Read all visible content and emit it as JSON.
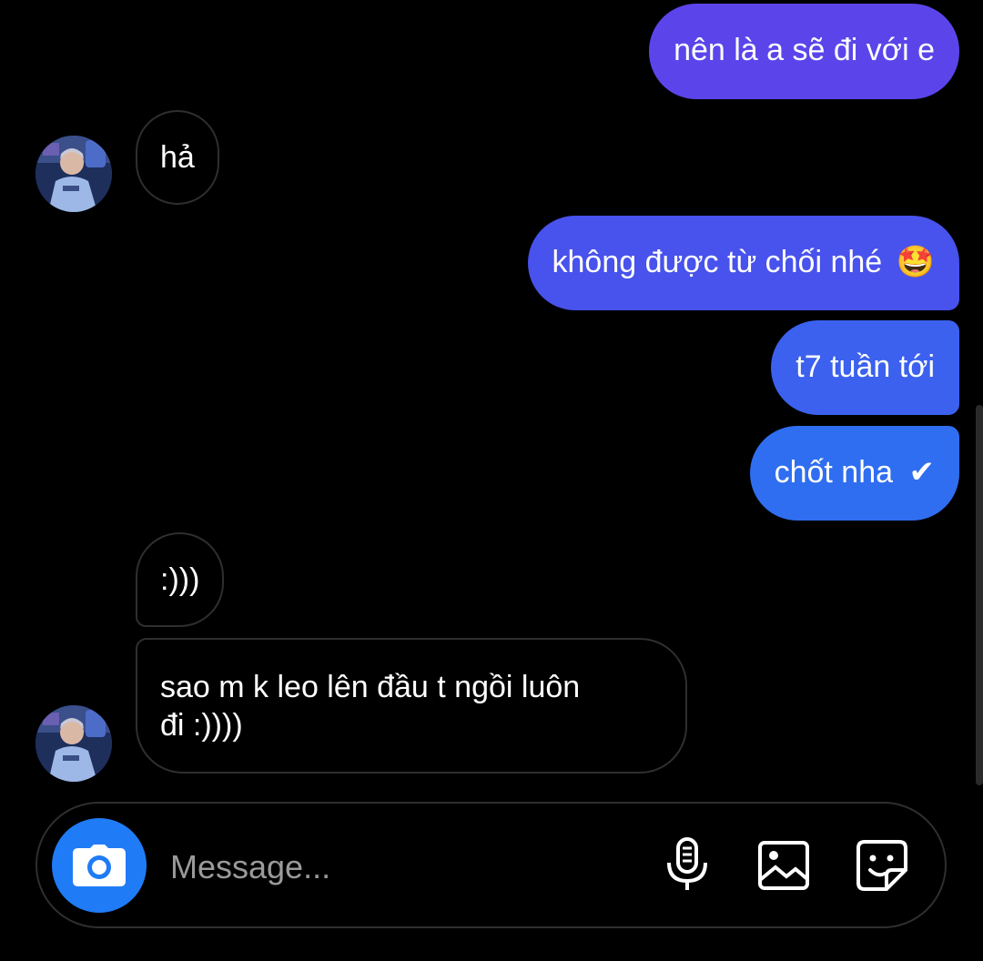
{
  "colors": {
    "background": "#000000",
    "sent_top": "#5b45ea",
    "sent_mid": "#4457ec",
    "sent_bottom": "#2f6ef0",
    "camera_button": "#1f7cf6"
  },
  "messages": [
    {
      "direction": "sent",
      "text": "nên là a sẽ đi với e"
    },
    {
      "direction": "received",
      "text": "hả"
    },
    {
      "direction": "sent",
      "text": "không được từ chối nhé",
      "emoji": "🤩"
    },
    {
      "direction": "sent",
      "text": "t7 tuần tới"
    },
    {
      "direction": "sent",
      "text": "chốt nha",
      "emoji": "✔"
    },
    {
      "direction": "received",
      "text": ":)))"
    },
    {
      "direction": "received",
      "text": "sao m k leo lên đầu t ngồi luôn",
      "text_line2": "đi :))))"
    }
  ],
  "composer": {
    "placeholder": "Message...",
    "icons": [
      "camera-icon",
      "microphone-icon",
      "gallery-icon",
      "sticker-icon"
    ]
  }
}
